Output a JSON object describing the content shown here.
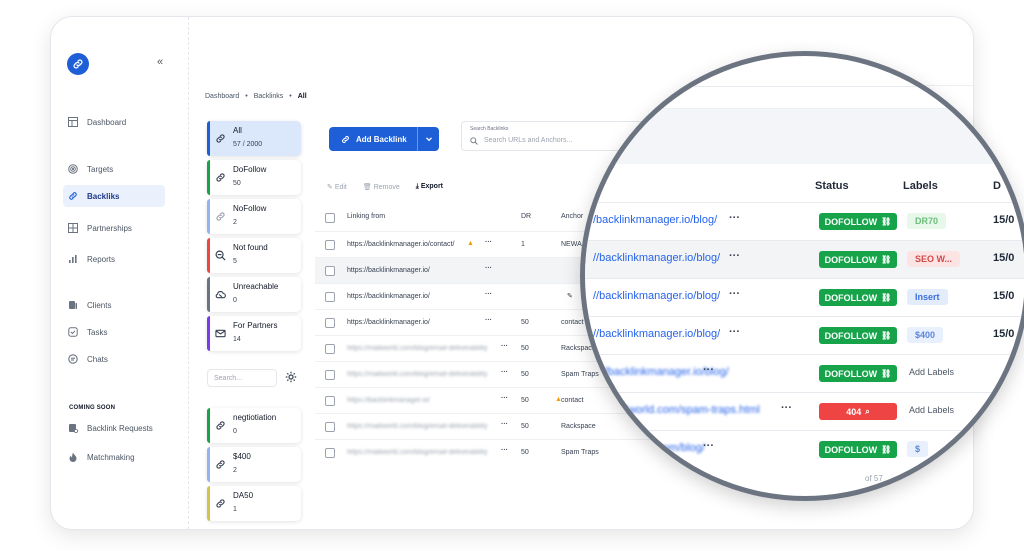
{
  "sidebar": {
    "nav": [
      {
        "label": "Dashboard",
        "icon": "dashboard-icon"
      },
      {
        "label": "Targets",
        "icon": "target-icon"
      },
      {
        "label": "Backliks",
        "icon": "link-icon",
        "active": true
      },
      {
        "label": "Partnerships",
        "icon": "grid-icon"
      },
      {
        "label": "Reports",
        "icon": "chart-icon"
      },
      {
        "label": "Clients",
        "icon": "clients-icon"
      },
      {
        "label": "Tasks",
        "icon": "tasks-icon"
      },
      {
        "label": "Chats",
        "icon": "chat-icon"
      }
    ],
    "coming_soon": "COMING SOON",
    "soon_items": [
      {
        "label": "Backlink Requests",
        "icon": "request-icon"
      },
      {
        "label": "Matchmaking",
        "icon": "fire-icon"
      }
    ]
  },
  "breadcrumb": [
    "Dashboard",
    "Backlinks",
    "All"
  ],
  "filters": [
    {
      "name": "All",
      "count": "57 / 2000",
      "color": "#1e5fd8",
      "selected": true
    },
    {
      "name": "DoFollow",
      "count": "50",
      "color": "#16a34a"
    },
    {
      "name": "NoFollow",
      "count": "2",
      "color": "#93b4ee"
    },
    {
      "name": "Not found",
      "count": "5",
      "color": "#ef4444"
    },
    {
      "name": "Unreachable",
      "count": "0",
      "color": "#6b7280"
    },
    {
      "name": "For Partners",
      "count": "14",
      "color": "#7c3aed"
    }
  ],
  "filter_search_placeholder": "Search...",
  "label_filters": [
    {
      "name": "negtiotiation",
      "count": "0",
      "color": "#16a34a"
    },
    {
      "name": "$400",
      "count": "2",
      "color": "#93b4ee"
    },
    {
      "name": "DA50",
      "count": "1",
      "color": "#d4c34a"
    }
  ],
  "toolbar": {
    "add_label": "Add Backlink",
    "search_label": "Search Backlinks",
    "search_placeholder": "Search URLs and Anchors...",
    "edit": "Edit",
    "remove": "Remove",
    "export": "Export"
  },
  "table": {
    "headers": {
      "linking_from": "Linking from",
      "dr": "DR",
      "anchor": "Anchor"
    },
    "rows": [
      {
        "url": "https://backlinkmanager.io/contact/",
        "warn": true,
        "dr": "1",
        "anchor": "NEWA"
      },
      {
        "url": "https://backlinkmanager.io/",
        "dr": "",
        "anchor": "",
        "hl": true
      },
      {
        "url": "https://backlinkmanager.io/",
        "dr": "",
        "anchor": "",
        "pen": true
      },
      {
        "url": "https://backlinkmanager.io/",
        "dr": "50",
        "anchor": "contact"
      },
      {
        "url": "https://mailworld.com/blog/email-deliverability",
        "blur": true,
        "dr": "50",
        "anchor": "Rackspace"
      },
      {
        "url": "https://mailworld.com/blog/email-deliverability",
        "blur": true,
        "dr": "50",
        "anchor": "Spam Traps"
      },
      {
        "url": "https://backlinkmanager.io/",
        "blur": true,
        "dr": "50",
        "anchor": "contact",
        "warn": true
      },
      {
        "url": "https://mailworld.com/blog/email-deliverability",
        "blur": true,
        "dr": "50",
        "anchor": "Rackspace"
      },
      {
        "url": "https://mailworld.com/blog/email-deliverability",
        "blur": true,
        "dr": "50",
        "anchor": "Spam Traps"
      }
    ]
  },
  "lens": {
    "headers": {
      "url": "o",
      "status": "Status",
      "labels": "Labels",
      "date": "D"
    },
    "rows": [
      {
        "url": "/backlinkmanager.io/blog/",
        "status": "DOFOLLOW",
        "ok": true,
        "label": "DR70",
        "label_style": "green",
        "date": "15/0"
      },
      {
        "url": "//backlinkmanager.io/blog/",
        "status": "DOFOLLOW",
        "ok": true,
        "label": "SEO W...",
        "label_style": "red",
        "date": "15/0",
        "hl": true
      },
      {
        "url": "//backlinkmanager.io/blog/",
        "status": "DOFOLLOW",
        "ok": true,
        "label": "Insert",
        "label_style": "blue",
        "date": "15/0"
      },
      {
        "url": "//backlinkmanager.io/blog/",
        "status": "DOFOLLOW",
        "ok": true,
        "label": "$400",
        "label_style": "blue2",
        "date": "15/0"
      },
      {
        "url": "s://backlinkmanager.io/blog/",
        "status": "DOFOLLOW",
        "ok": true,
        "add": "Add Labels",
        "blur": true
      },
      {
        "url": "s://mailworld.com/spam-traps.html",
        "status": "404",
        "ok": false,
        "add": "Add Labels",
        "blur": true
      },
      {
        "url": "s://mailworld.com/blog/",
        "status": "DOFOLLOW",
        "ok": true,
        "label": "$",
        "label_style": "blue2",
        "date": "13/0",
        "blur": true
      }
    ],
    "pager": "of 57"
  }
}
